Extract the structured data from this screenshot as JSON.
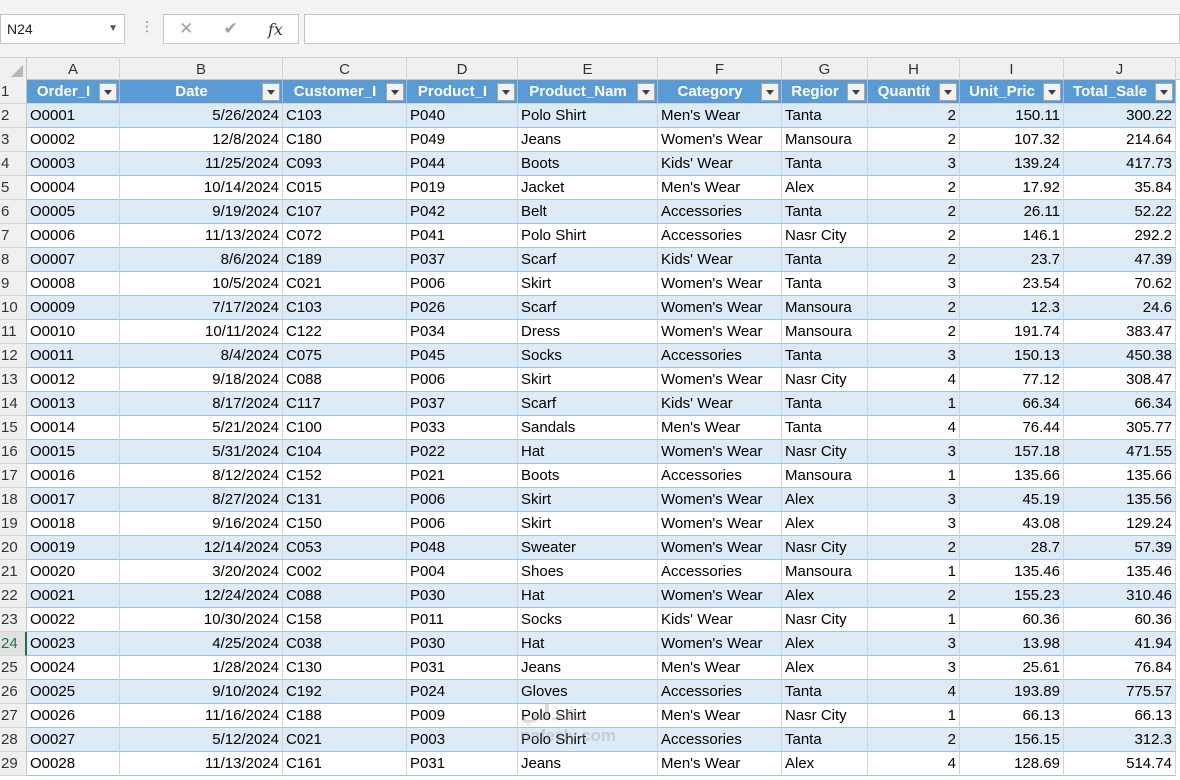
{
  "formula_bar": {
    "name_box": "N24",
    "cancel_icon": "✕",
    "enter_icon": "✔",
    "fx_label": "fx",
    "formula": ""
  },
  "columns": [
    "A",
    "B",
    "C",
    "D",
    "E",
    "F",
    "G",
    "H",
    "I",
    "J"
  ],
  "headers": [
    "Order_I",
    "Date",
    "Customer_I",
    "Product_I",
    "Product_Nam",
    "Category",
    "Regior",
    "Quantit",
    "Unit_Pric",
    "Total_Sale"
  ],
  "row_numbers": [
    "1",
    "2",
    "3",
    "4",
    "5",
    "6",
    "7",
    "8",
    "9",
    "10",
    "11",
    "12",
    "13",
    "14",
    "15",
    "16",
    "17",
    "18",
    "19",
    "20",
    "21",
    "22",
    "23",
    "24",
    "25",
    "26",
    "27",
    "28",
    "29"
  ],
  "active_row": "24",
  "rows": [
    [
      "O0001",
      "5/26/2024",
      "C103",
      "P040",
      "Polo Shirt",
      "Men's Wear",
      "Tanta",
      "2",
      "150.11",
      "300.22"
    ],
    [
      "O0002",
      "12/8/2024",
      "C180",
      "P049",
      "Jeans",
      "Women's Wear",
      "Mansoura",
      "2",
      "107.32",
      "214.64"
    ],
    [
      "O0003",
      "11/25/2024",
      "C093",
      "P044",
      "Boots",
      "Kids' Wear",
      "Tanta",
      "3",
      "139.24",
      "417.73"
    ],
    [
      "O0004",
      "10/14/2024",
      "C015",
      "P019",
      "Jacket",
      "Men's Wear",
      "Alex",
      "2",
      "17.92",
      "35.84"
    ],
    [
      "O0005",
      "9/19/2024",
      "C107",
      "P042",
      "Belt",
      "Accessories",
      "Tanta",
      "2",
      "26.11",
      "52.22"
    ],
    [
      "O0006",
      "11/13/2024",
      "C072",
      "P041",
      "Polo Shirt",
      "Accessories",
      "Nasr City",
      "2",
      "146.1",
      "292.2"
    ],
    [
      "O0007",
      "8/6/2024",
      "C189",
      "P037",
      "Scarf",
      "Kids' Wear",
      "Tanta",
      "2",
      "23.7",
      "47.39"
    ],
    [
      "O0008",
      "10/5/2024",
      "C021",
      "P006",
      "Skirt",
      "Women's Wear",
      "Tanta",
      "3",
      "23.54",
      "70.62"
    ],
    [
      "O0009",
      "7/17/2024",
      "C103",
      "P026",
      "Scarf",
      "Women's Wear",
      "Mansoura",
      "2",
      "12.3",
      "24.6"
    ],
    [
      "O0010",
      "10/11/2024",
      "C122",
      "P034",
      "Dress",
      "Women's Wear",
      "Mansoura",
      "2",
      "191.74",
      "383.47"
    ],
    [
      "O0011",
      "8/4/2024",
      "C075",
      "P045",
      "Socks",
      "Accessories",
      "Tanta",
      "3",
      "150.13",
      "450.38"
    ],
    [
      "O0012",
      "9/18/2024",
      "C088",
      "P006",
      "Skirt",
      "Women's Wear",
      "Nasr City",
      "4",
      "77.12",
      "308.47"
    ],
    [
      "O0013",
      "8/17/2024",
      "C117",
      "P037",
      "Scarf",
      "Kids' Wear",
      "Tanta",
      "1",
      "66.34",
      "66.34"
    ],
    [
      "O0014",
      "5/21/2024",
      "C100",
      "P033",
      "Sandals",
      "Men's Wear",
      "Tanta",
      "4",
      "76.44",
      "305.77"
    ],
    [
      "O0015",
      "5/31/2024",
      "C104",
      "P022",
      "Hat",
      "Women's Wear",
      "Nasr City",
      "3",
      "157.18",
      "471.55"
    ],
    [
      "O0016",
      "8/12/2024",
      "C152",
      "P021",
      "Boots",
      "Accessories",
      "Mansoura",
      "1",
      "135.66",
      "135.66"
    ],
    [
      "O0017",
      "8/27/2024",
      "C131",
      "P006",
      "Skirt",
      "Women's Wear",
      "Alex",
      "3",
      "45.19",
      "135.56"
    ],
    [
      "O0018",
      "9/16/2024",
      "C150",
      "P006",
      "Skirt",
      "Women's Wear",
      "Alex",
      "3",
      "43.08",
      "129.24"
    ],
    [
      "O0019",
      "12/14/2024",
      "C053",
      "P048",
      "Sweater",
      "Women's Wear",
      "Nasr City",
      "2",
      "28.7",
      "57.39"
    ],
    [
      "O0020",
      "3/20/2024",
      "C002",
      "P004",
      "Shoes",
      "Accessories",
      "Mansoura",
      "1",
      "135.46",
      "135.46"
    ],
    [
      "O0021",
      "12/24/2024",
      "C088",
      "P030",
      "Hat",
      "Women's Wear",
      "Alex",
      "2",
      "155.23",
      "310.46"
    ],
    [
      "O0022",
      "10/30/2024",
      "C158",
      "P011",
      "Socks",
      "Kids' Wear",
      "Nasr City",
      "1",
      "60.36",
      "60.36"
    ],
    [
      "O0023",
      "4/25/2024",
      "C038",
      "P030",
      "Hat",
      "Women's Wear",
      "Alex",
      "3",
      "13.98",
      "41.94"
    ],
    [
      "O0024",
      "1/28/2024",
      "C130",
      "P031",
      "Jeans",
      "Men's Wear",
      "Alex",
      "3",
      "25.61",
      "76.84"
    ],
    [
      "O0025",
      "9/10/2024",
      "C192",
      "P024",
      "Gloves",
      "Accessories",
      "Tanta",
      "4",
      "193.89",
      "775.57"
    ],
    [
      "O0026",
      "11/16/2024",
      "C188",
      "P009",
      "Polo Shirt",
      "Men's Wear",
      "Nasr City",
      "1",
      "66.13",
      "66.13"
    ],
    [
      "O0027",
      "5/12/2024",
      "C021",
      "P003",
      "Polo Shirt",
      "Accessories",
      "Tanta",
      "2",
      "156.15",
      "312.3"
    ],
    [
      "O0028",
      "11/13/2024",
      "C161",
      "P031",
      "Jeans",
      "Men's Wear",
      "Alex",
      "4",
      "128.69",
      "514.74"
    ]
  ],
  "numeric_columns": [
    1,
    7,
    8,
    9
  ],
  "watermark": {
    "arabic": "نفذلي",
    "latin": "nafezly.com"
  }
}
